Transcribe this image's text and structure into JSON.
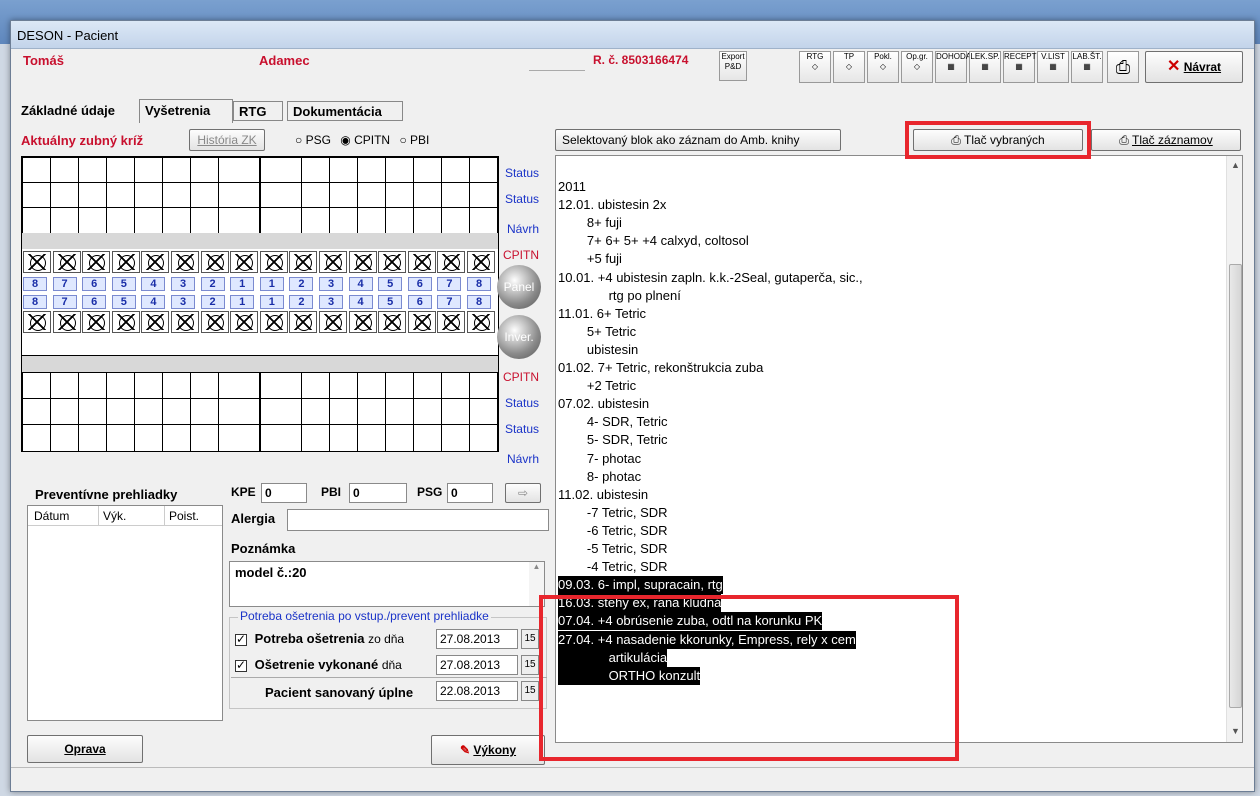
{
  "window": {
    "title": "DESON - Pacient"
  },
  "patient": {
    "first_name": "Tomáš",
    "last_name": "Adamec",
    "rc": "R. č. 8503166474"
  },
  "toolbar": {
    "export": "Export",
    "icons": [
      "RTG",
      "TP",
      "Pokl.",
      "Op.gr.",
      "DOHODA",
      "LEK.SP.",
      "RECEPT",
      "V.LIST",
      "LAB.ŠT."
    ],
    "navrat": "Návrat"
  },
  "tabs": [
    "Základné údaje",
    "Vyšetrenia",
    "RTG",
    "Dokumentácia"
  ],
  "dental": {
    "title": "Aktuálny zubný kríž",
    "history_btn": "História ZK",
    "radio": [
      "PSG",
      "CPITN",
      "PBI"
    ],
    "side_top": [
      "Status",
      "Status",
      "Návrh",
      "CPITN"
    ],
    "side_bottom": [
      "CPITN",
      "Status",
      "Status",
      "Návrh"
    ],
    "panel_btn": "Panel",
    "inver_btn": "Inver.",
    "numbers_left": [
      "8",
      "7",
      "6",
      "5",
      "4",
      "3",
      "2",
      "1"
    ],
    "numbers_right": [
      "1",
      "2",
      "3",
      "4",
      "5",
      "6",
      "7",
      "8"
    ]
  },
  "preventive": {
    "title": "Preventívne prehliadky",
    "columns": [
      "Dátum",
      "Výk.",
      "Poist."
    ]
  },
  "indices": {
    "kpe_label": "KPE",
    "kpe": "0",
    "pbi_label": "PBI",
    "pbi": "0",
    "psg_label": "PSG",
    "psg": "0"
  },
  "alergia": {
    "label": "Alergia",
    "value": ""
  },
  "poznamka": {
    "label": "Poznámka",
    "value": "model č.:20"
  },
  "treatment": {
    "group": "Potreba ošetrenia po vstup./prevent prehliadke",
    "potreba_label": "Potreba ošetrenia",
    "potreba_zo": "zo dňa",
    "potreba_date": "27.08.2013",
    "osetrenie_label": "Ošetrenie vykonané",
    "osetrenie_dna": "dňa",
    "osetrenie_date": "27.08.2013",
    "sanovany_label": "Pacient sanovaný úplne",
    "sanovany_date": "22.08.2013",
    "cal_icon": "15"
  },
  "buttons": {
    "oprava": "Oprava",
    "vykony": "Výkony",
    "selected_block": "Selektovaný blok  ako záznam do Amb. knihy",
    "print_selected": "Tlač vybraných",
    "print_records": "Tlač záznamov"
  },
  "records": [
    {
      "text": "2011",
      "hl": false
    },
    {
      "text": "12.01. ubistesin 2x",
      "hl": false
    },
    {
      "text": "        8+ fuji",
      "hl": false
    },
    {
      "text": "        7+ 6+ 5+ +4 calxyd, coltosol",
      "hl": false
    },
    {
      "text": "        +5 fuji",
      "hl": false
    },
    {
      "text": "10.01. +4 ubistesin zapln. k.k.-2Seal, gutaperča, sic.,",
      "hl": false
    },
    {
      "text": "              rtg po plnení",
      "hl": false
    },
    {
      "text": "11.01. 6+ Tetric",
      "hl": false
    },
    {
      "text": "        5+ Tetric",
      "hl": false
    },
    {
      "text": "        ubistesin",
      "hl": false
    },
    {
      "text": "01.02. 7+ Tetric, rekonštrukcia zuba",
      "hl": false
    },
    {
      "text": "        +2 Tetric",
      "hl": false
    },
    {
      "text": "07.02. ubistesin",
      "hl": false
    },
    {
      "text": "        4- SDR, Tetric",
      "hl": false
    },
    {
      "text": "        5- SDR, Tetric",
      "hl": false
    },
    {
      "text": "        7- photac",
      "hl": false
    },
    {
      "text": "        8- photac",
      "hl": false
    },
    {
      "text": "11.02. ubistesin",
      "hl": false
    },
    {
      "text": "        -7 Tetric, SDR",
      "hl": false
    },
    {
      "text": "        -6 Tetric, SDR",
      "hl": false
    },
    {
      "text": "        -5 Tetric, SDR",
      "hl": false
    },
    {
      "text": "        -4 Tetric, SDR",
      "hl": false
    },
    {
      "text": "09.03. 6- impl, supracain, rtg",
      "hl": true
    },
    {
      "text": "16.03. stehy ex, rana kludná",
      "hl": true
    },
    {
      "text": "07.04. +4 obrúsenie zuba, odtl na korunku PK",
      "hl": true
    },
    {
      "text": "27.04. +4 nasadenie kkorunky, Empress, rely x cem",
      "hl": true
    },
    {
      "text": "              artikulácia",
      "hl": true
    },
    {
      "text": "              ORTHO konzult",
      "hl": true
    }
  ],
  "colors": {
    "highlight_box": "#e8262d",
    "name_red": "#c8102e",
    "blue_label": "#1a33c8"
  }
}
